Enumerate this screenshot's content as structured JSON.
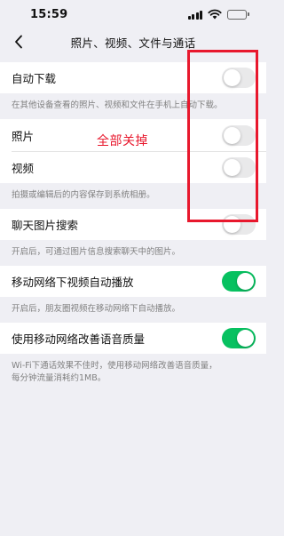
{
  "status": {
    "time": "15:59"
  },
  "nav": {
    "title": "照片、视频、文件与通话"
  },
  "sections": {
    "auto_download": {
      "label": "自动下载",
      "on": false,
      "desc": "在其他设备查看的照片、视频和文件在手机上自动下载。"
    },
    "save": {
      "photo_label": "照片",
      "photo_on": false,
      "video_label": "视频",
      "video_on": false,
      "desc": "拍摄或编辑后的内容保存到系统相册。"
    },
    "image_search": {
      "label": "聊天图片搜索",
      "on": false,
      "desc": "开启后，可通过图片信息搜索聊天中的图片。"
    },
    "autoplay": {
      "label": "移动网络下视频自动播放",
      "on": true,
      "desc": "开启后，朋友圈视频在移动网络下自动播放。"
    },
    "call_quality": {
      "label": "使用移动网络改善语音质量",
      "on": true,
      "desc_line1": "Wi-Fi下通话效果不佳时，使用移动网络改善语音质量，",
      "desc_line2": "每分钟流量消耗约1MB。"
    }
  },
  "annotation": {
    "text": "全部关掉",
    "color": "#e8182d"
  },
  "colors": {
    "toggle_on": "#07c160",
    "toggle_off": "#e9e9ea",
    "background": "#efeff4"
  }
}
